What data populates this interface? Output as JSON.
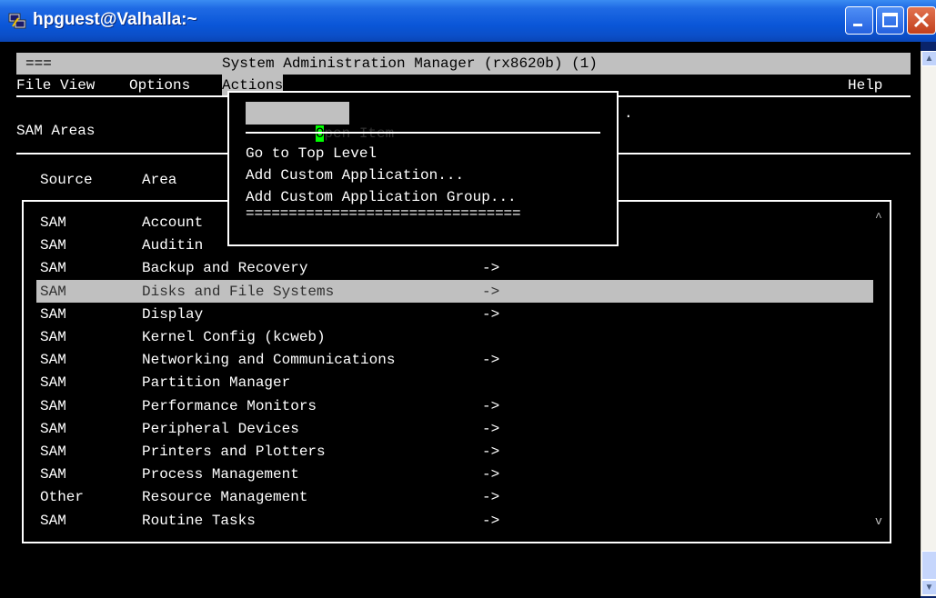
{
  "window": {
    "title": "hpguest@Valhalla:~"
  },
  "terminal": {
    "title_left": "===",
    "title_center": "System Administration Manager (rx8620b) (1)",
    "menu": {
      "file": "File",
      "view": "View",
      "options": "Options",
      "actions": "Actions",
      "help": "Help"
    },
    "section_label": "SAM Areas",
    "columns": {
      "source": "Source",
      "area": "Area"
    },
    "dropdown": {
      "open_item": "Open Item",
      "go_top_level": "Go to Top Level",
      "add_custom_app": "Add Custom Application...",
      "add_custom_app_group": "Add Custom Application Group...",
      "separator": "================================"
    },
    "rows": [
      {
        "source": "SAM",
        "area": "Account",
        "arrow": ""
      },
      {
        "source": "SAM",
        "area": "Auditin",
        "arrow": ""
      },
      {
        "source": "SAM",
        "area": "Backup and Recovery",
        "arrow": "->"
      },
      {
        "source": "SAM",
        "area": "Disks and File Systems",
        "arrow": "->"
      },
      {
        "source": "SAM",
        "area": "Display",
        "arrow": "->"
      },
      {
        "source": "SAM",
        "area": "Kernel Config (kcweb)",
        "arrow": ""
      },
      {
        "source": "SAM",
        "area": "Networking and Communications",
        "arrow": "->"
      },
      {
        "source": "SAM",
        "area": "Partition Manager",
        "arrow": ""
      },
      {
        "source": "SAM",
        "area": "Performance Monitors",
        "arrow": "->"
      },
      {
        "source": "SAM",
        "area": "Peripheral Devices",
        "arrow": "->"
      },
      {
        "source": "SAM",
        "area": "Printers and Plotters",
        "arrow": "->"
      },
      {
        "source": "SAM",
        "area": "Process Management",
        "arrow": "->"
      },
      {
        "source": "Other",
        "area": "Resource Management",
        "arrow": "->"
      },
      {
        "source": "SAM",
        "area": "Routine Tasks",
        "arrow": "->"
      }
    ],
    "dot": "."
  },
  "colors": {
    "terminal_bg": "#000000",
    "terminal_fg": "#ffffff",
    "highlight_bg": "#c0c0c0",
    "cursor": "#00ff00",
    "xp_titlebar": "#0a56d8"
  }
}
